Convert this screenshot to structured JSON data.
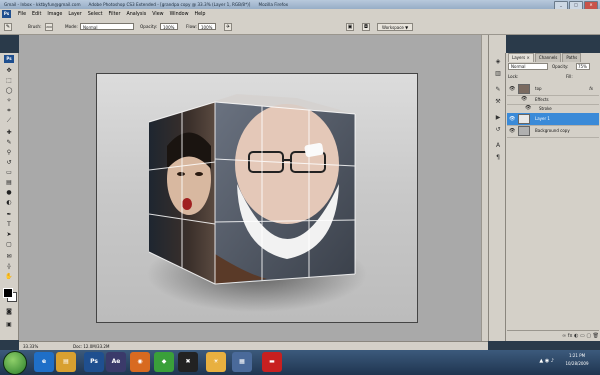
{
  "browser": {
    "tabs": [
      {
        "label": "Gmail - Inbox - kktbyfun@gmail.com"
      },
      {
        "label": "Adobe Photoshop CS3 Extended - [grandpa copy @ 33.3% (Layer 1, RGB/8*)]"
      },
      {
        "label": "Mozilla Firefox"
      }
    ],
    "window_buttons": {
      "min": "_",
      "max": "□",
      "close": "✕"
    }
  },
  "app": {
    "logo": "Ps",
    "menus": [
      "File",
      "Edit",
      "Image",
      "Layer",
      "Select",
      "Filter",
      "Analysis",
      "View",
      "Window",
      "Help"
    ]
  },
  "options_bar": {
    "brush_label": "Brush:",
    "brush_size": "200",
    "mode_label": "Mode:",
    "mode_value": "Normal",
    "opacity_label": "Opacity:",
    "opacity_value": "100%",
    "flow_label": "Flow:",
    "flow_value": "100%",
    "workspace_label": "Workspace ▼"
  },
  "status_bar": {
    "zoom": "33.33%",
    "doc": "Doc: 12.0M/33.2M"
  },
  "layers_panel": {
    "tabs": [
      "Layers ×",
      "Channels",
      "Paths"
    ],
    "blend_mode": "Normal",
    "opacity_label": "Opacity:",
    "opacity_value": "75%",
    "lock_label": "Lock:",
    "fill_label": "Fill:",
    "layers": [
      {
        "name": "top",
        "fx": "fx"
      },
      {
        "name": "Effects"
      },
      {
        "name": "Stroke"
      },
      {
        "name": "Layer 1"
      },
      {
        "name": "Background copy"
      }
    ],
    "footer_icons": "∞ fx ◐ ▭ ▢ 🗑"
  },
  "taskbar": {
    "items": [
      {
        "label": "e",
        "color": "#1f6fc8"
      },
      {
        "label": "▤",
        "color": "#d8a030"
      },
      {
        "label": "Ps",
        "color": "#1f4f8f"
      },
      {
        "label": "Ae",
        "color": "#3a3a6a"
      },
      {
        "label": "◉",
        "color": "#d86a20"
      },
      {
        "label": "◆",
        "color": "#3aa03a"
      },
      {
        "label": "✖",
        "color": "#222"
      },
      {
        "label": "☀",
        "color": "#e8b040"
      },
      {
        "label": "▦",
        "color": "#4a6a9a"
      },
      {
        "label": "▬",
        "color": "#c82020"
      }
    ],
    "clock_time": "1:21 PM",
    "clock_date": "10/28/2009"
  },
  "colors": {
    "accent": "#3a8ad8",
    "chrome": "#d4d0c8",
    "canvas_bg": "#a9a9a9"
  }
}
